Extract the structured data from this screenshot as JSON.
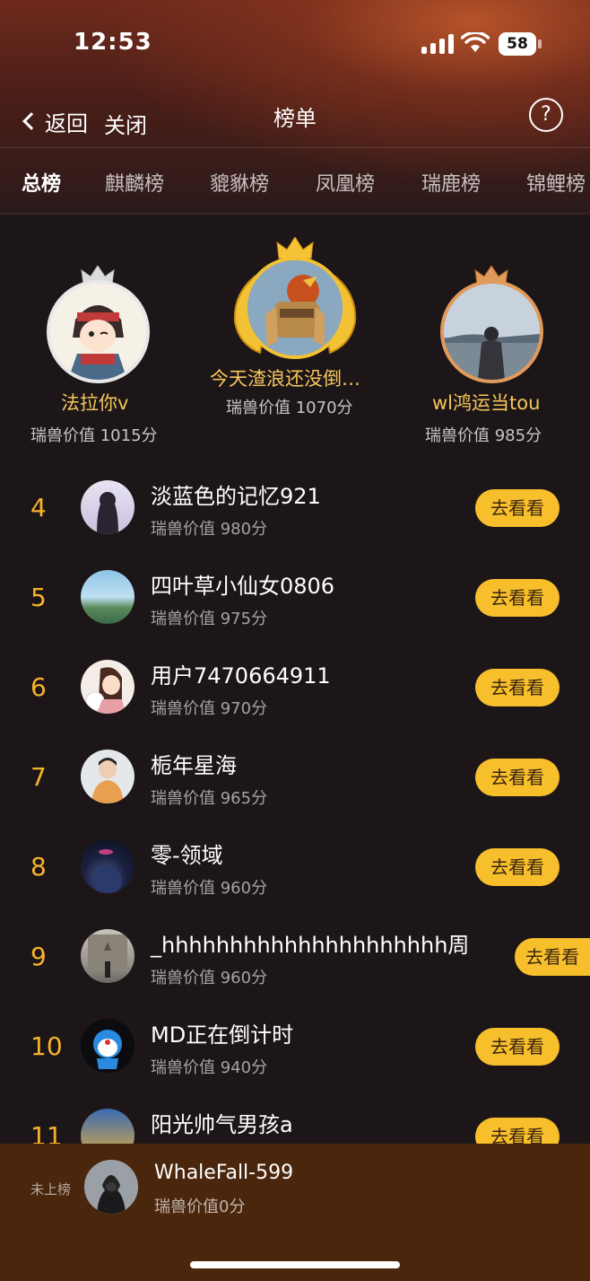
{
  "status_bar": {
    "time": "12:53",
    "battery": "58"
  },
  "nav": {
    "back_label": "返回",
    "close_label": "关闭",
    "title": "榜单",
    "help_glyph": "?"
  },
  "tabs": [
    {
      "label": "总榜",
      "active": true
    },
    {
      "label": "麒麟榜",
      "active": false
    },
    {
      "label": "貔貅榜",
      "active": false
    },
    {
      "label": "凤凰榜",
      "active": false
    },
    {
      "label": "瑞鹿榜",
      "active": false
    },
    {
      "label": "锦鲤榜",
      "active": false
    }
  ],
  "podium": {
    "first": {
      "name": "今天渣浪还没倒…",
      "score": "瑞兽价值 1070分"
    },
    "second": {
      "name": "法拉你v",
      "score": "瑞兽价值 1015分"
    },
    "third": {
      "name": "wl鸿运当tou",
      "score": "瑞兽价值 985分"
    }
  },
  "ranking": [
    {
      "rank": "4",
      "name": "淡蓝色的记忆921",
      "score": "瑞兽价值 980分",
      "button": "去看看"
    },
    {
      "rank": "5",
      "name": "四叶草小仙女0806",
      "score": "瑞兽价值 975分",
      "button": "去看看"
    },
    {
      "rank": "6",
      "name": "用户7470664911",
      "score": "瑞兽价值 970分",
      "button": "去看看"
    },
    {
      "rank": "7",
      "name": "栀年星海",
      "score": "瑞兽价值 965分",
      "button": "去看看"
    },
    {
      "rank": "8",
      "name": "零-领域",
      "score": "瑞兽价值 960分",
      "button": "去看看"
    },
    {
      "rank": "9",
      "name": "_hhhhhhhhhhhhhhhhhhhhh周",
      "score": "瑞兽价值 960分",
      "button": "去看看"
    },
    {
      "rank": "10",
      "name": "MD正在倒计时",
      "score": "瑞兽价值 940分",
      "button": "去看看"
    },
    {
      "rank": "11",
      "name": "阳光帅气男孩a",
      "score": "",
      "button": "去看看"
    }
  ],
  "my_rank": {
    "status": "未上榜",
    "name": "WhaleFall-599",
    "score": "瑞兽价值0分"
  },
  "colors": {
    "accent": "#f7b32b",
    "button_bg": "#f8bf2c",
    "footer_bg": "#4a260d",
    "page_bg": "#1c1618"
  }
}
